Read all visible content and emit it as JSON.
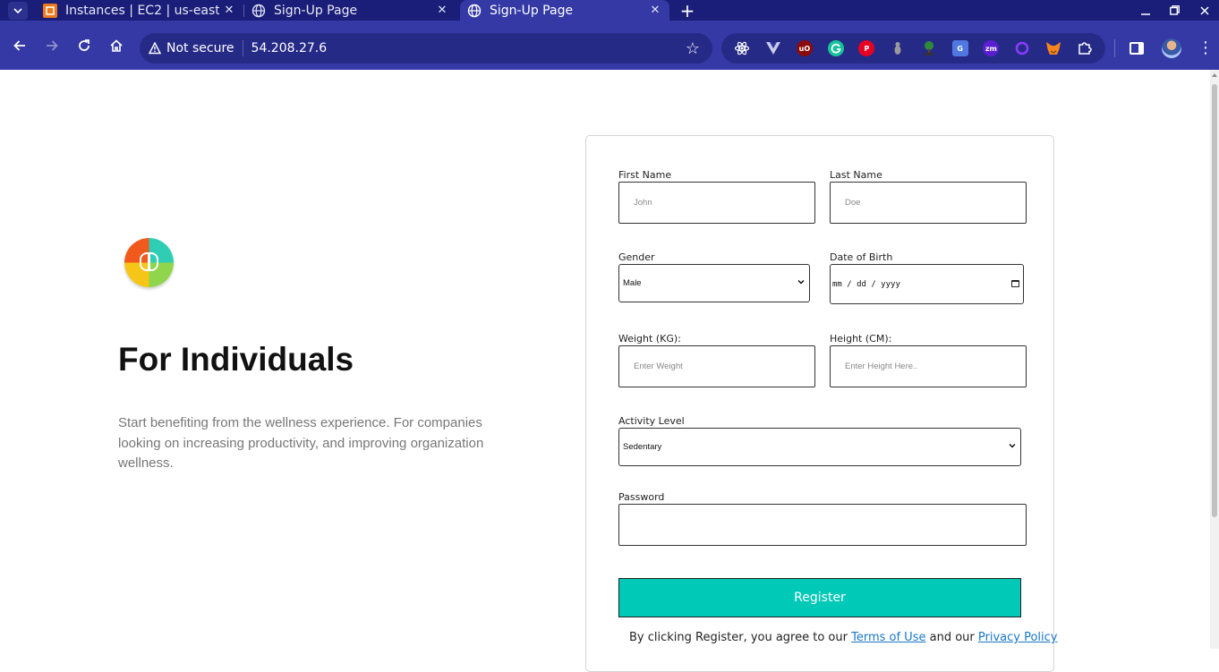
{
  "browser": {
    "tabs": [
      {
        "title": "Instances | EC2 | us-east-",
        "favicon": "aws-icon",
        "active": false
      },
      {
        "title": "Sign-Up Page",
        "favicon": "globe-icon",
        "active": false
      },
      {
        "title": "Sign-Up Page",
        "favicon": "globe-icon",
        "active": true
      }
    ],
    "security_label": "Not secure",
    "url": "54.208.27.6",
    "extensions": [
      "react-devtools-icon",
      "vue-devtools-icon",
      "ublock-icon",
      "grammarly-icon",
      "pinterest-icon",
      "extension-generic-icon",
      "bonsai-icon",
      "google-translate-icon",
      "zoom-icon",
      "circle-extension-icon",
      "metamask-icon",
      "puzzle-icon"
    ],
    "colors": {
      "tabbar": "#1a1e78",
      "toolbar": "#3539a6",
      "omnibox": "#262a87"
    }
  },
  "hero": {
    "title": "For Individuals",
    "text": "Start benefiting from the wellness experience. For companies looking on increasing productivity, and improving organization wellness."
  },
  "form": {
    "first_name": {
      "label": "First Name",
      "placeholder": "John"
    },
    "last_name": {
      "label": "Last Name",
      "placeholder": "Doe"
    },
    "gender": {
      "label": "Gender",
      "value": "Male"
    },
    "dob": {
      "label": "Date of Birth",
      "placeholder": "mm / dd / yyyy"
    },
    "weight": {
      "label": "Weight (KG):",
      "placeholder": "Enter Weight"
    },
    "height": {
      "label": "Height (CM):",
      "placeholder": "Enter Height Here.."
    },
    "activity": {
      "label": "Activity Level",
      "value": "Sedentary"
    },
    "password": {
      "label": "Password",
      "value": ""
    },
    "register_label": "Register",
    "agree_prefix": "By clicking Register, you agree to our",
    "terms_link": "Terms of Use",
    "agree_middle": "and our",
    "privacy_link": "Privacy Policy",
    "colors": {
      "register": "#00c9b7",
      "link": "#1976c9"
    }
  }
}
